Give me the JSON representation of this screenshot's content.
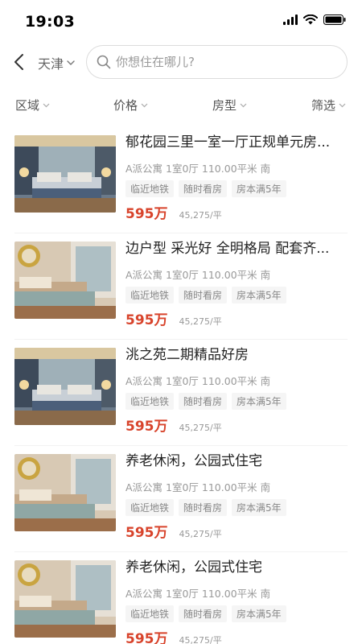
{
  "status_bar": {
    "time": "19:03"
  },
  "header": {
    "city": "天津",
    "search_placeholder": "你想住在哪儿?"
  },
  "filters": [
    "区域",
    "价格",
    "房型",
    "筛选"
  ],
  "listings": [
    {
      "title": "郁花园三里一室一厅正规单元房...",
      "meta": "A派公寓 1室0厅 110.00平米 南",
      "tags": [
        "临近地铁",
        "随时看房",
        "房本满5年"
      ],
      "price": "595万",
      "unit_price": "45,275/平",
      "image": "bedroom-photo"
    },
    {
      "title": "边户型 采光好 全明格局 配套齐...",
      "meta": "A派公寓 1室0厅 110.00平米 南",
      "tags": [
        "临近地铁",
        "随时看房",
        "房本满5年"
      ],
      "price": "595万",
      "unit_price": "45,275/平",
      "image": "bedroom-photo"
    },
    {
      "title": "洮之苑二期精品好房",
      "meta": "A派公寓 1室0厅 110.00平米 南",
      "tags": [
        "临近地铁",
        "随时看房",
        "房本满5年"
      ],
      "price": "595万",
      "unit_price": "45,275/平",
      "image": "bedroom-photo"
    },
    {
      "title": "养老休闲，公园式住宅",
      "meta": "A派公寓 1室0厅 110.00平米 南",
      "tags": [
        "临近地铁",
        "随时看房",
        "房本满5年"
      ],
      "price": "595万",
      "unit_price": "45,275/平",
      "image": "bedroom-photo"
    },
    {
      "title": "养老休闲，公园式住宅",
      "meta": "A派公寓 1室0厅 110.00平米 南",
      "tags": [
        "临近地铁",
        "随时看房",
        "房本满5年"
      ],
      "price": "595万",
      "unit_price": "45,275/平",
      "image": "bedroom-photo"
    }
  ],
  "colors": {
    "price": "#d8442c",
    "tag_bg": "#f5f5f5"
  }
}
